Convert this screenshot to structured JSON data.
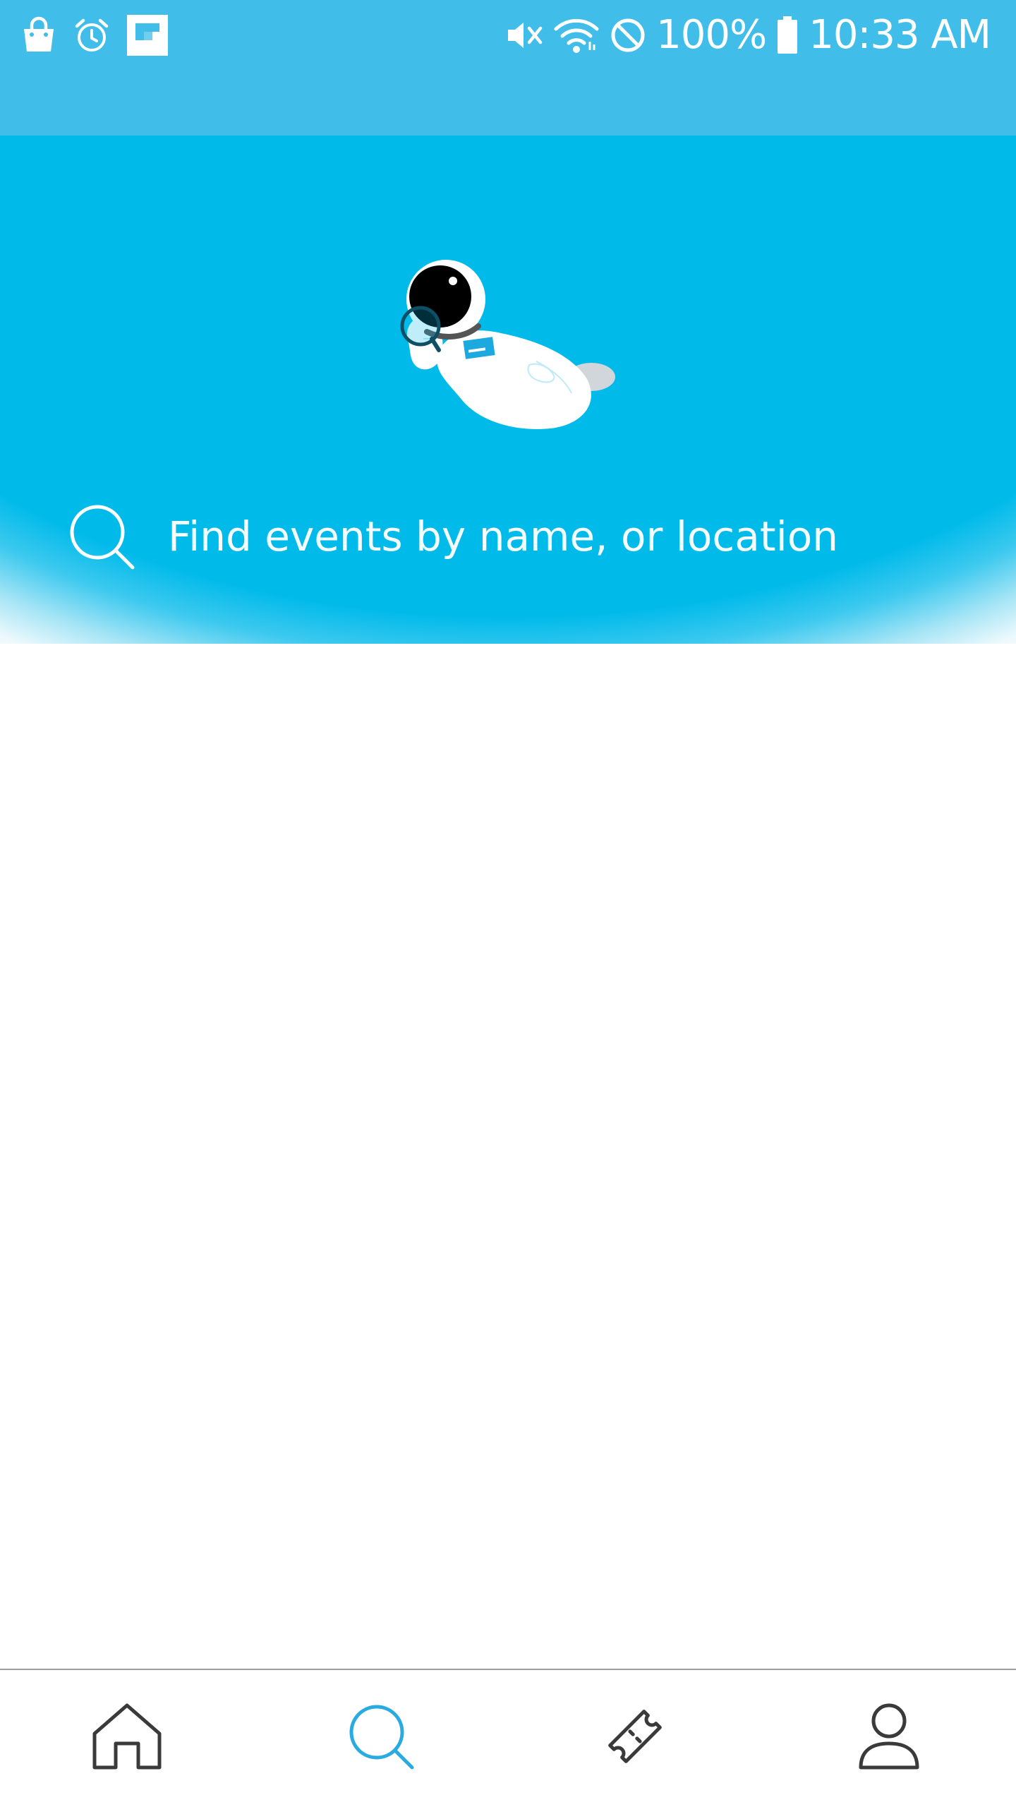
{
  "status_bar": {
    "battery_percent": "100%",
    "time": "10:33 AM",
    "left_icons": [
      "shopping-bag-icon",
      "alarm-icon",
      "flipboard-icon"
    ],
    "right_icons": [
      "vibrate-mute-icon",
      "wifi-icon",
      "do-not-disturb-icon",
      "battery-icon"
    ]
  },
  "search": {
    "placeholder": "Find events by name, or location",
    "icon": "search-icon"
  },
  "hero": {
    "illustration": "astronaut-with-magnifier-illustration"
  },
  "bottom_nav": {
    "items": [
      {
        "id": "home",
        "icon": "home-icon",
        "active": false
      },
      {
        "id": "search",
        "icon": "search-icon",
        "active": true
      },
      {
        "id": "tickets",
        "icon": "ticket-icon",
        "active": false
      },
      {
        "id": "profile",
        "icon": "profile-icon",
        "active": false
      }
    ]
  },
  "colors": {
    "status_bar": "#40BDE9",
    "hero": "#00BAEA",
    "active_nav": "#29ABE2",
    "inactive_nav": "#3A3A3A",
    "background": "#FFFFFF"
  }
}
